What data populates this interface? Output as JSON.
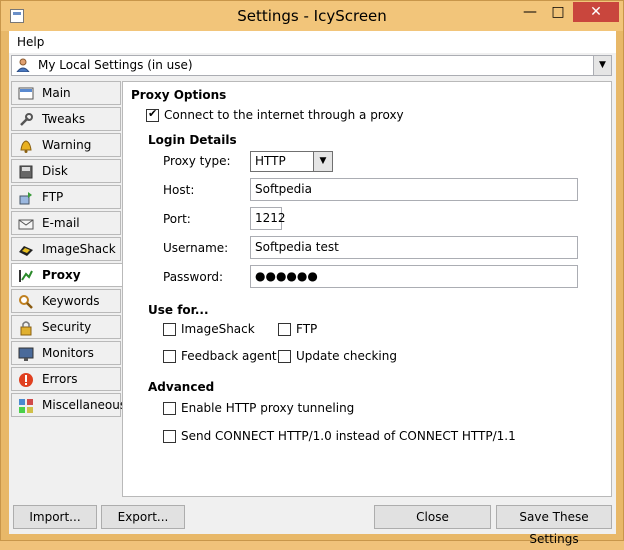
{
  "window": {
    "title": "Settings - IcyScreen"
  },
  "menu": {
    "help": "Help"
  },
  "profile": {
    "value": "My Local Settings (in use)"
  },
  "tabs": [
    {
      "label": "Main",
      "icon": "main-icon"
    },
    {
      "label": "Tweaks",
      "icon": "wrench-icon"
    },
    {
      "label": "Warning",
      "icon": "bell-icon"
    },
    {
      "label": "Disk",
      "icon": "disk-icon"
    },
    {
      "label": "FTP",
      "icon": "ftp-icon"
    },
    {
      "label": "E-mail",
      "icon": "email-icon"
    },
    {
      "label": "ImageShack",
      "icon": "imageshack-icon"
    },
    {
      "label": "Proxy",
      "icon": "proxy-icon"
    },
    {
      "label": "Keywords",
      "icon": "magnifier-icon"
    },
    {
      "label": "Security",
      "icon": "lock-icon"
    },
    {
      "label": "Monitors",
      "icon": "monitor-icon"
    },
    {
      "label": "Errors",
      "icon": "error-icon"
    },
    {
      "label": "Miscellaneous",
      "icon": "misc-icon"
    }
  ],
  "proxy": {
    "title": "Proxy Options",
    "connect_label": "Connect to the internet through a proxy",
    "login_title": "Login Details",
    "proxy_type_label": "Proxy type:",
    "proxy_type_value": "HTTP",
    "host_label": "Host:",
    "host_value": "Softpedia",
    "port_label": "Port:",
    "port_value": "1212",
    "username_label": "Username:",
    "username_value": "Softpedia test",
    "password_label": "Password:",
    "password_value": "●●●●●●",
    "usefor_title": "Use for...",
    "imageshack_label": "ImageShack",
    "ftp_label": "FTP",
    "feedback_label": "Feedback agent",
    "update_label": "Update checking",
    "advanced_title": "Advanced",
    "tunneling_label": "Enable HTTP proxy tunneling",
    "connect10_label": "Send CONNECT HTTP/1.0 instead of CONNECT HTTP/1.1"
  },
  "buttons": {
    "import": "Import...",
    "export": "Export...",
    "close": "Close",
    "save": "Save These Settings"
  }
}
